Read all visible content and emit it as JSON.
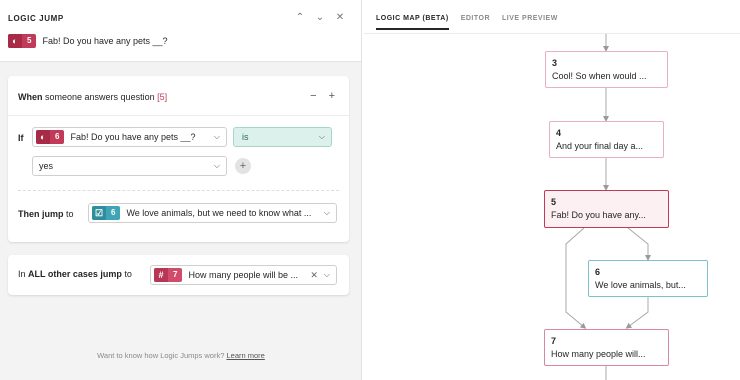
{
  "panel": {
    "title": "LOGIC JUMP",
    "question": {
      "number": "5",
      "text": "Fab! Do you have any pets __?"
    }
  },
  "rule": {
    "when_prefix": "When",
    "when_text": "someone answers question",
    "when_question": "[5]",
    "if_label": "If",
    "if_question": {
      "number": "6",
      "text": "Fab! Do you have any pets __?"
    },
    "operator": "is",
    "value": "yes",
    "then_label": "Then jump",
    "then_to": "to",
    "then_target": {
      "number": "6",
      "text": "We love animals, but we need to know what ..."
    }
  },
  "else_rule": {
    "prefix": "In",
    "bold": "ALL other cases jump",
    "to": "to",
    "target": {
      "number": "7",
      "text": "How many people will be ..."
    }
  },
  "footer": {
    "text": "Want to know how Logic Jumps work?",
    "link": "Learn more"
  },
  "tabs": [
    "LOGIC MAP (BETA)",
    "EDITOR",
    "LIVE PREVIEW"
  ],
  "nodes": [
    {
      "number": "3",
      "text": "Cool! So when would ..."
    },
    {
      "number": "4",
      "text": "And your final day a..."
    },
    {
      "number": "5",
      "text": "Fab! Do you have any..."
    },
    {
      "number": "6",
      "text": "We love animals, but..."
    },
    {
      "number": "7",
      "text": "How many people will..."
    }
  ],
  "icons": {
    "question_type": "opinion-scale-icon",
    "checkbox": "checkbox-icon",
    "number": "number-icon"
  },
  "colors": {
    "brand": "#c23a59",
    "teal": "#3fa4b5",
    "condition": "#dcf1eb"
  }
}
